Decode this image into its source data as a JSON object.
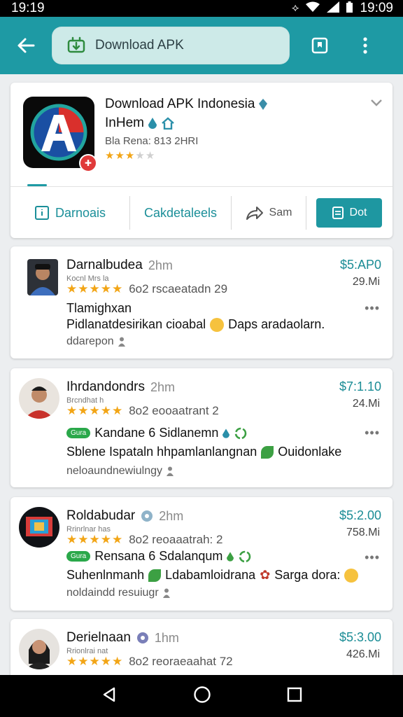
{
  "status_bar": {
    "time_left": "19:19",
    "time_right": "19:09"
  },
  "app_bar": {
    "search_text": "Download APK",
    "icons": [
      "back-arrow-icon",
      "apk-download-icon",
      "bookmark-icon",
      "overflow-icon"
    ]
  },
  "app_header": {
    "title": "Download APK Indonesia",
    "subtitle": "InHem",
    "meta": "Bla Rena: 813 2HRI",
    "rating_stars": 2.5,
    "actions": [
      {
        "label": "Darnoais",
        "icon": "info-icon"
      },
      {
        "label": "Cakdetaleels"
      },
      {
        "label": "Sam",
        "icon": "share-icon"
      },
      {
        "label": "Dot",
        "icon": "document-icon"
      }
    ]
  },
  "reviews": [
    {
      "name": "Darnalbudea",
      "ago": "2hm",
      "handle": "Kocnl Mrs la",
      "stat": "6o2 rscaeatadn 29",
      "price": "$5:AP0",
      "size": "29.Mi",
      "line1": "Tlamighxan",
      "line2": "Pidlanatdesirikan cioabal",
      "line2_after": "Daps aradaolarn.",
      "line3": "ddarepon"
    },
    {
      "name": "Ihrdandondrs",
      "ago": "2hm",
      "handle": "Brcndhat h",
      "stat": "8o2 eooaatrant 2",
      "price": "$7:1.10",
      "size": "24.Mi",
      "tag": "Gura",
      "line1": "Kandane 6 Sidlanemn",
      "line2": "Sblene Ispataln hhpamlanlangnan",
      "line2_after": "Ouidonlake",
      "line3": "neloaundnewiulngy"
    },
    {
      "name": "Roldabudar",
      "ago": "2hm",
      "handle": "Rrinrlnar has",
      "stat": "8o2 reoaaatrah: 2",
      "price": "$5:2.00",
      "size": "758.Mi",
      "tag": "Gura",
      "line1": "Rensana 6 Sdalanqum",
      "line2": "Suhenlnmanh",
      "line2_mid": "Ldabamloidrana",
      "line2_after": "Sarga dora:",
      "line3": "noldaindd resuiugr"
    },
    {
      "name": "Derielnaan",
      "ago": "1hm",
      "handle": "Rrionlrai nat",
      "stat": "8o2 reoraeaahat 72",
      "price": "$5:3.00",
      "size": "426.Mi"
    }
  ],
  "colors": {
    "accent": "#1e9aa4",
    "price": "#1a8c95",
    "star": "#f2a516",
    "tag_green": "#2aa84a"
  }
}
